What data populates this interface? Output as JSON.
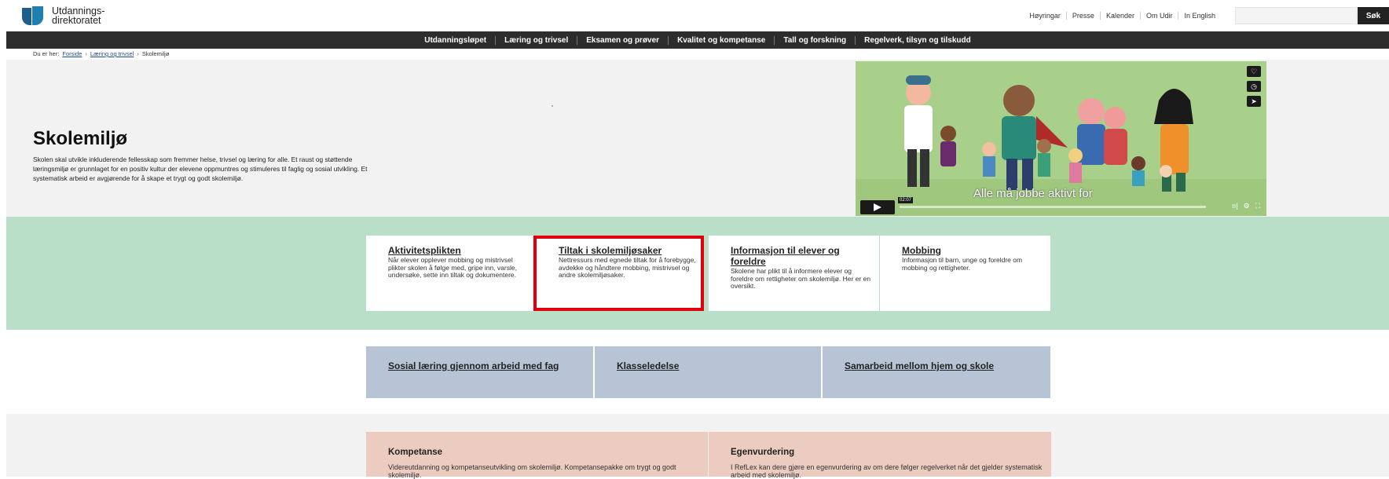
{
  "header": {
    "logo_line1": "Utdannings-",
    "logo_line2": "direktoratet",
    "utility_links": [
      "Høyringar",
      "Presse",
      "Kalender",
      "Om Udir",
      "In English"
    ],
    "search_placeholder": "",
    "search_button": "Søk"
  },
  "nav": {
    "items": [
      "Utdanningsløpet",
      "Læring og trivsel",
      "Eksamen og prøver",
      "Kvalitet og kompetanse",
      "Tall og forskning",
      "Regelverk, tilsyn og tilskudd"
    ]
  },
  "breadcrumb": {
    "prefix": "Du er her:",
    "items": [
      "Forside",
      "Læring og trivsel",
      "Skolemiljø"
    ],
    "sep": "›"
  },
  "hero": {
    "title": "Skolemiljø",
    "description": "Skolen skal utvikle inkluderende fellesskap som fremmer helse, trivsel og læring for alle. Et raust og støttende læringsmiljø er grunnlaget for en positiv kultur der elevene oppmuntres og stimuleres til faglig og sosial utvikling. Et systematisk arbeid er avgjørende for å skape et trygt og godt skolemiljø."
  },
  "video": {
    "caption": "Alle må jobbe aktivt for",
    "time": "02:07"
  },
  "cards": [
    {
      "title": "Aktivitetsplikten",
      "text": "Når elever opplever mobbing og mistrivsel plikter skolen å følge med, gripe inn, varsle, undersøke, sette inn tiltak og dokumentere."
    },
    {
      "title": "Tiltak i skolemiljøsaker",
      "text": "Nettressurs med egnede tiltak for å forebygge, avdekke og håndtere mobbing, mistrivsel og andre skolemiljøsaker."
    },
    {
      "title": "Informasjon til elever og foreldre",
      "text": "Skolene har plikt til å informere elever og foreldre om rettigheter om skolemiljø. Her er en oversikt."
    },
    {
      "title": "Mobbing",
      "text": "Informasjon til barn, unge og foreldre om mobbing og rettigheter."
    }
  ],
  "topics": [
    {
      "title": "Sosial læring gjennom arbeid med fag"
    },
    {
      "title": "Klasseledelse"
    },
    {
      "title": "Samarbeid mellom hjem og skole"
    }
  ],
  "bottom": [
    {
      "title": "Kompetanse",
      "text": "Videreutdanning og kompetanseutvikling om skolemiljø. Kompetansepakke om trygt og godt skolemiljø."
    },
    {
      "title": "Egenvurdering",
      "text": "I RefLex kan dere gjøre en egenvurdering av om dere følger regelverket når det gjelder systematisk arbeid med skolemiljø."
    }
  ],
  "colors": {
    "nav_bg": "#2d2d2d",
    "hero_bg": "#f2f2f2",
    "green_band": "#b9dfc8",
    "blue_tile": "#b7c4d6",
    "peach_tile": "#ecccc0",
    "highlight": "#e0000c"
  }
}
